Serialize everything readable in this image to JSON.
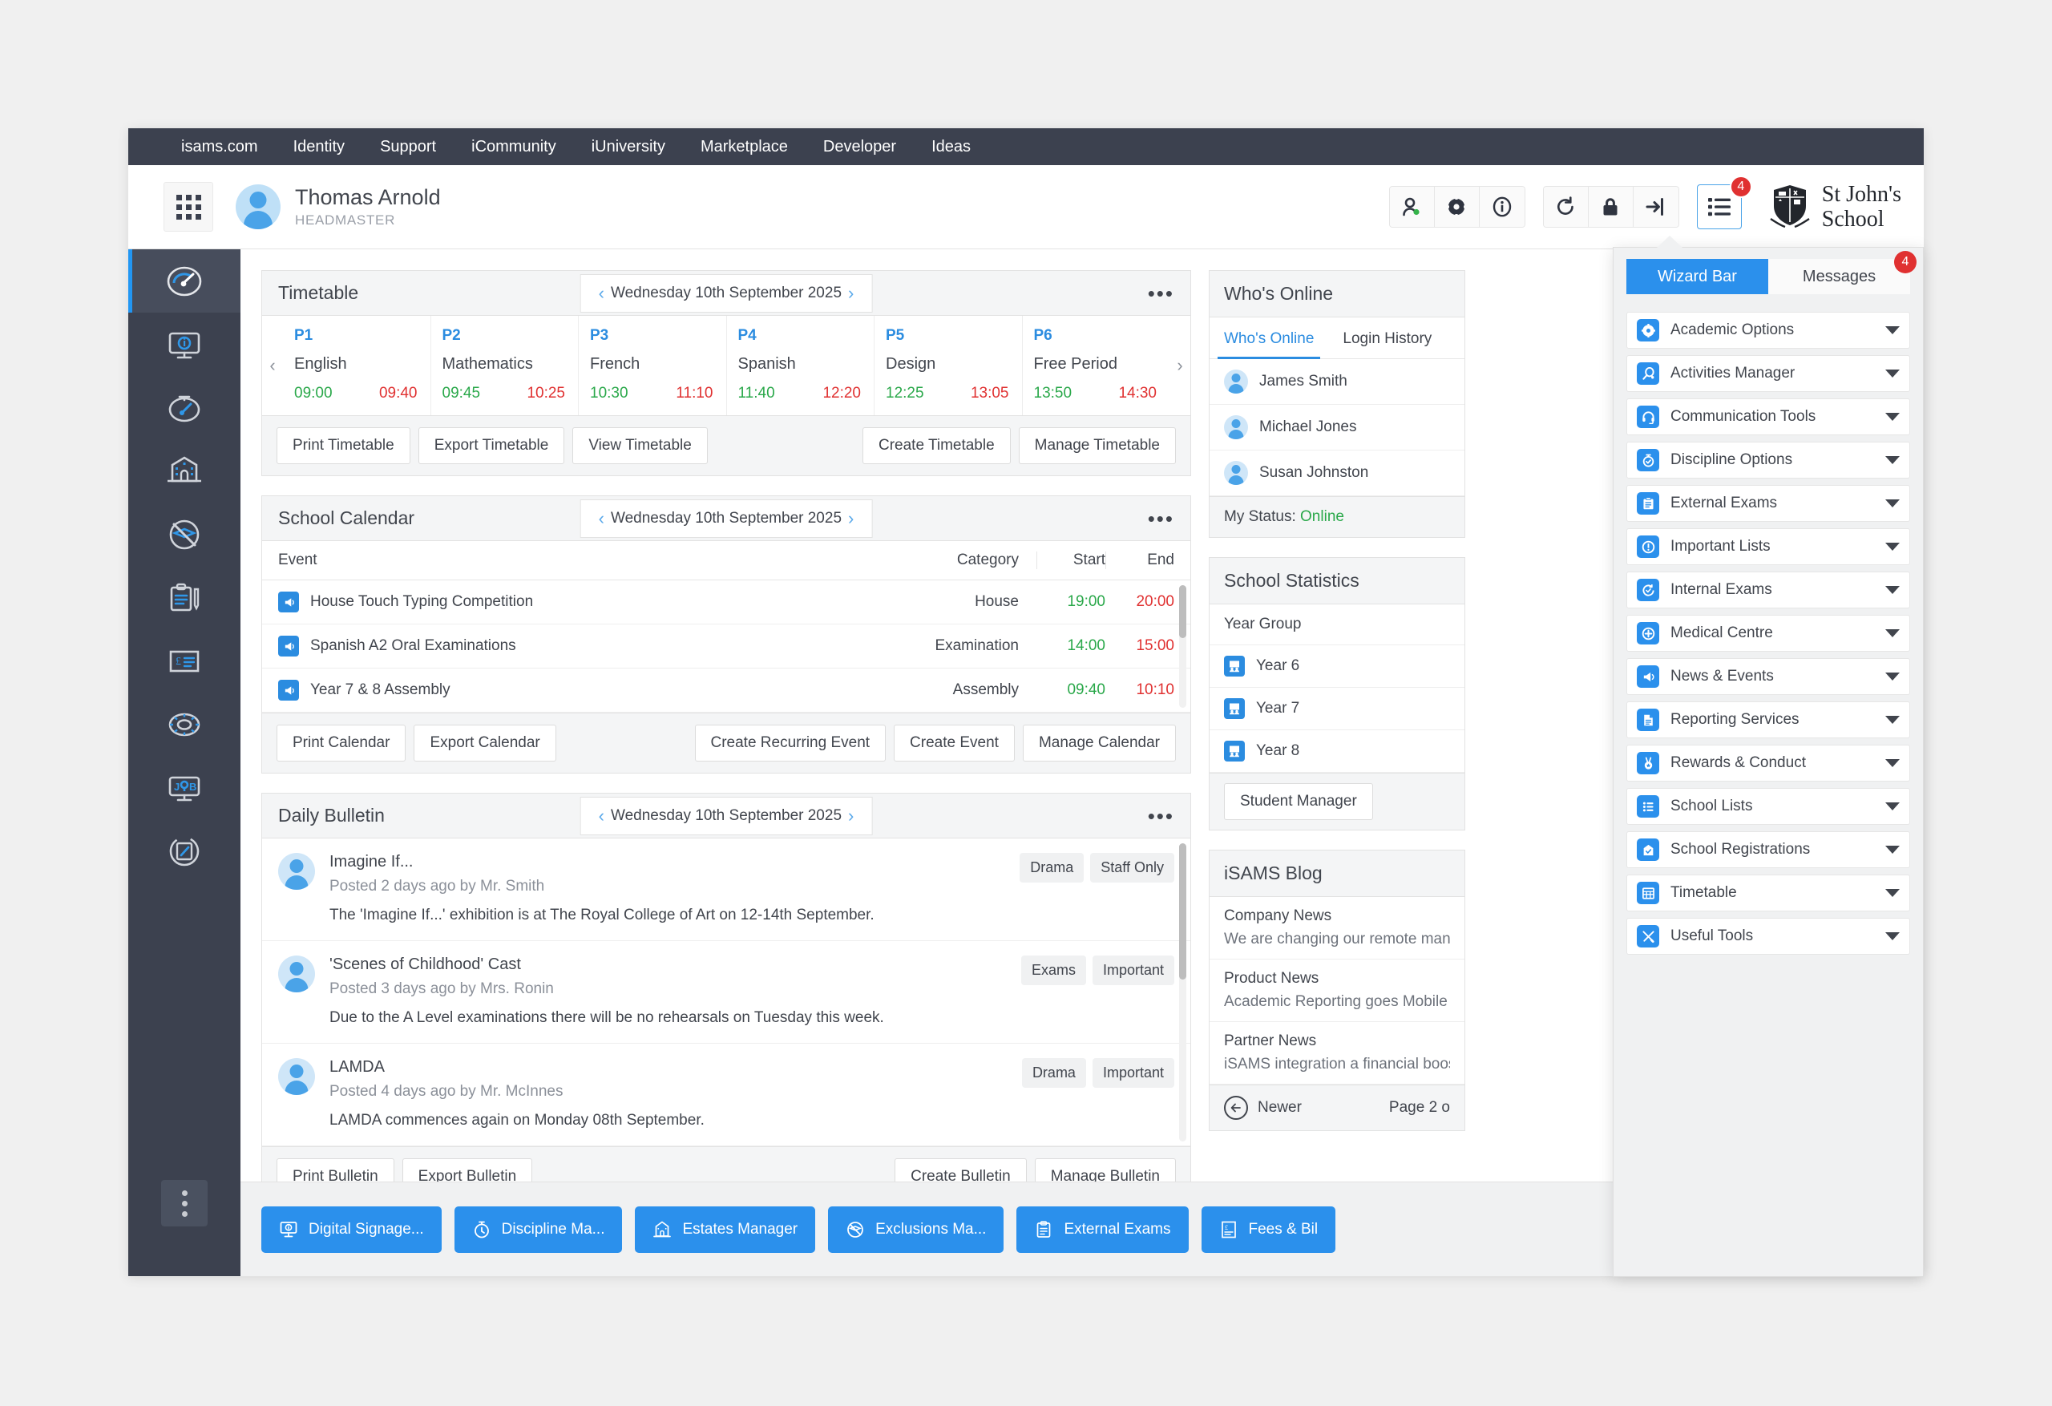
{
  "topnav": {
    "items": [
      "isams.com",
      "Identity",
      "Support",
      "iCommunity",
      "iUniversity",
      "Marketplace",
      "Developer",
      "Ideas"
    ]
  },
  "header": {
    "user_name": "Thomas Arnold",
    "user_role": "HEADMASTER",
    "icons": [
      "user-status-icon",
      "gear-icon",
      "info-icon",
      "refresh-icon",
      "lock-icon",
      "logout-icon"
    ],
    "wizard_badge": "4",
    "school_line1": "St John's",
    "school_line2": "School"
  },
  "rail": {
    "items": [
      "dashboard-gauge-icon",
      "monitor-info-icon",
      "compass-icon",
      "school-building-icon",
      "exclusions-icon",
      "clipboard-pencil-icon",
      "fees-receipt-icon",
      "lifebuoy-icon",
      "job-board-icon",
      "registrations-icon"
    ]
  },
  "timetable": {
    "title": "Timetable",
    "date": "Wednesday 10th September 2025",
    "periods": [
      {
        "code": "P1",
        "subject": "English",
        "start": "09:00",
        "end": "09:40"
      },
      {
        "code": "P2",
        "subject": "Mathematics",
        "start": "09:45",
        "end": "10:25"
      },
      {
        "code": "P3",
        "subject": "French",
        "start": "10:30",
        "end": "11:10"
      },
      {
        "code": "P4",
        "subject": "Spanish",
        "start": "11:40",
        "end": "12:20"
      },
      {
        "code": "P5",
        "subject": "Design",
        "start": "12:25",
        "end": "13:05"
      },
      {
        "code": "P6",
        "subject": "Free Period",
        "start": "13:50",
        "end": "14:30"
      }
    ],
    "buttons_left": [
      "Print Timetable",
      "Export Timetable",
      "View Timetable"
    ],
    "buttons_right": [
      "Create Timetable",
      "Manage Timetable"
    ]
  },
  "calendar": {
    "title": "School Calendar",
    "date": "Wednesday 10th September 2025",
    "columns": [
      "Event",
      "Category",
      "Start",
      "End"
    ],
    "rows": [
      {
        "event": "House Touch Typing Competition",
        "category": "House",
        "start": "19:00",
        "end": "20:00"
      },
      {
        "event": "Spanish A2 Oral Examinations",
        "category": "Examination",
        "start": "14:00",
        "end": "15:00"
      },
      {
        "event": "Year 7 & 8 Assembly",
        "category": "Assembly",
        "start": "09:40",
        "end": "10:10"
      }
    ],
    "buttons_left": [
      "Print Calendar",
      "Export Calendar"
    ],
    "buttons_right": [
      "Create Recurring Event",
      "Create Event",
      "Manage Calendar"
    ]
  },
  "bulletin": {
    "title": "Daily Bulletin",
    "date": "Wednesday 10th September 2025",
    "rows": [
      {
        "title": "Imagine If...",
        "meta": "Posted 2 days ago by Mr. Smith",
        "text": "The 'Imagine If...' exhibition is at The Royal College of Art on 12-14th September.",
        "tags": [
          "Drama",
          "Staff Only"
        ]
      },
      {
        "title": "'Scenes of Childhood' Cast",
        "meta": "Posted 3 days ago by Mrs. Ronin",
        "text": "Due to the A Level examinations there will be no rehearsals on Tuesday this week.",
        "tags": [
          "Exams",
          "Important"
        ]
      },
      {
        "title": "LAMDA",
        "meta": "Posted 4 days ago by Mr. McInnes",
        "text": "LAMDA commences again on Monday 08th September.",
        "tags": [
          "Drama",
          "Important"
        ]
      }
    ],
    "buttons_left": [
      "Print Bulletin",
      "Export Bulletin"
    ],
    "buttons_right": [
      "Create Bulletin",
      "Manage Bulletin"
    ]
  },
  "whos_online": {
    "title": "Who's Online",
    "tabs": [
      "Who's Online",
      "Login History"
    ],
    "active_tab": "Who's Online",
    "users": [
      "James Smith",
      "Michael Jones",
      "Susan Johnston"
    ],
    "status_label": "My Status:",
    "status_value": "Online"
  },
  "school_stats": {
    "title": "School Statistics",
    "subhead": "Year Group",
    "rows": [
      "Year 6",
      "Year 7",
      "Year 8"
    ],
    "button": "Student Manager"
  },
  "blog": {
    "title": "iSAMS Blog",
    "items": [
      {
        "category": "Company News",
        "summary": "We are changing our remote manage"
      },
      {
        "category": "Product News",
        "summary": "Academic Reporting goes Mobile wi"
      },
      {
        "category": "Partner News",
        "summary": "iSAMS integration a financial boost f"
      }
    ],
    "newer": "Newer",
    "page": "Page 2 o"
  },
  "appbar": {
    "tiles": [
      {
        "label": "Digital Signage...",
        "icon": "monitor-info-icon"
      },
      {
        "label": "Discipline Ma...",
        "icon": "stopwatch-icon"
      },
      {
        "label": "Estates Manager",
        "icon": "school-building-icon"
      },
      {
        "label": "Exclusions Ma...",
        "icon": "exclusions-icon"
      },
      {
        "label": "External Exams",
        "icon": "clipboard-check-icon"
      },
      {
        "label": "Fees & Bil",
        "icon": "fees-receipt-icon"
      }
    ]
  },
  "wizard": {
    "tabs": [
      "Wizard Bar",
      "Messages"
    ],
    "active_tab": "Wizard Bar",
    "messages_badge": "4",
    "items": [
      {
        "label": "Academic Options",
        "icon": "gear-icon"
      },
      {
        "label": "Activities Manager",
        "icon": "racket-icon"
      },
      {
        "label": "Communication Tools",
        "icon": "headset-icon"
      },
      {
        "label": "Discipline Options",
        "icon": "stopwatch-icon"
      },
      {
        "label": "External Exams",
        "icon": "clipboard-check-icon"
      },
      {
        "label": "Important Lists",
        "icon": "exclamation-circle-icon"
      },
      {
        "label": "Internal Exams",
        "icon": "clock-check-icon"
      },
      {
        "label": "Medical Centre",
        "icon": "plus-circle-icon"
      },
      {
        "label": "News & Events",
        "icon": "megaphone-icon"
      },
      {
        "label": "Reporting Services",
        "icon": "document-icon"
      },
      {
        "label": "Rewards & Conduct",
        "icon": "medal-icon"
      },
      {
        "label": "School Lists",
        "icon": "list-icon"
      },
      {
        "label": "School Registrations",
        "icon": "registrations-icon"
      },
      {
        "label": "Timetable",
        "icon": "table-icon"
      },
      {
        "label": "Useful Tools",
        "icon": "tools-icon"
      }
    ]
  },
  "colors": {
    "accent": "#2b90ec",
    "dark": "#3c414f",
    "green": "#2aa84a",
    "red": "#e03131"
  }
}
